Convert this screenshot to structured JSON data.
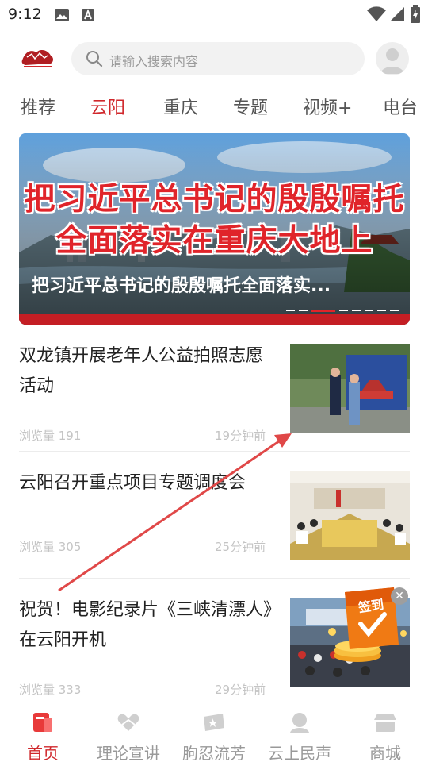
{
  "status_bar": {
    "time": "9:12"
  },
  "search": {
    "placeholder": "请输入搜索内容"
  },
  "tabs": [
    {
      "label": "推荐",
      "active": false
    },
    {
      "label": "云阳",
      "active": true
    },
    {
      "label": "重庆",
      "active": false
    },
    {
      "label": "专题",
      "active": false
    },
    {
      "label": "视频+",
      "active": false
    },
    {
      "label": "电台",
      "active": false
    }
  ],
  "banner": {
    "headline_line1": "把习近平总书记的殷殷嘱托",
    "headline_line2": "全面落实在重庆大地上",
    "caption": "把习近平总书记的殷殷嘱托全面落实...",
    "slide_count": 8,
    "active_slide": 3
  },
  "news": [
    {
      "title": "双龙镇开展老年人公益拍照志愿活动",
      "views": "浏览量 191",
      "time": "19分钟前"
    },
    {
      "title": "云阳召开重点项目专题调度会",
      "views": "浏览量 305",
      "time": "25分钟前"
    },
    {
      "title": "祝贺！电影纪录片《三峡清漂人》在云阳开机",
      "views": "浏览量 333",
      "time": "29分钟前"
    }
  ],
  "checkin": {
    "label": "签到"
  },
  "bottom_nav": [
    {
      "label": "首页",
      "icon": "home-icon",
      "active": true
    },
    {
      "label": "理论宣讲",
      "icon": "heart-hands-icon",
      "active": false
    },
    {
      "label": "朐忍流芳",
      "icon": "ticket-icon",
      "active": false
    },
    {
      "label": "云上民声",
      "icon": "person-icon",
      "active": false
    },
    {
      "label": "商城",
      "icon": "store-icon",
      "active": false
    }
  ],
  "colors": {
    "accent": "#d0282c",
    "muted_text": "#999999",
    "search_bg": "#f2f2f2",
    "annotation_arrow": "#e04848"
  }
}
